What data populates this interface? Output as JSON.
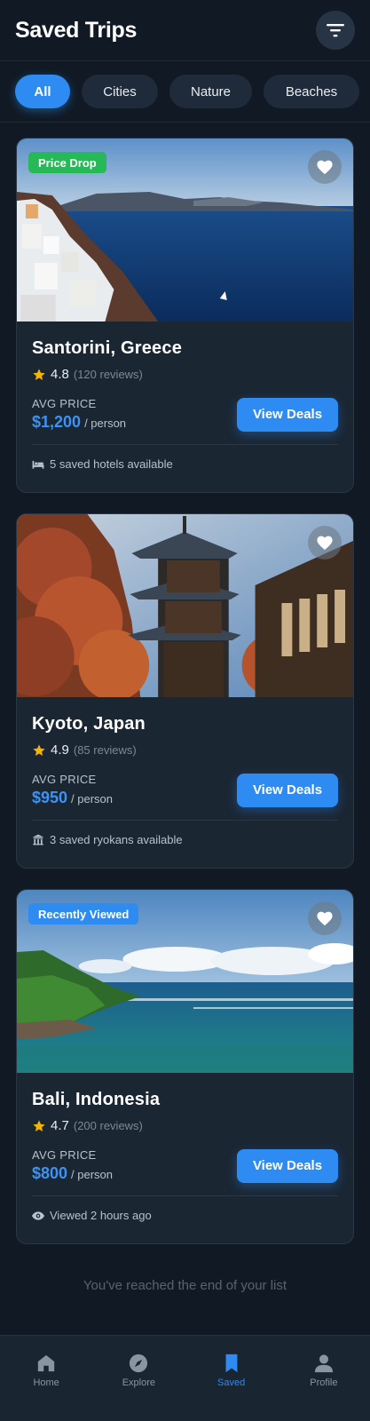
{
  "header": {
    "title": "Saved Trips",
    "filter_icon": "filter-icon"
  },
  "filters": [
    "All",
    "Cities",
    "Nature",
    "Beaches"
  ],
  "active_filter": "All",
  "cards": [
    {
      "badge": "Price Drop",
      "title": "Santorini, Greece",
      "rating": "4.8",
      "reviews": "(120 reviews)",
      "avg_label": "AVG PRICE",
      "price": "$1,200",
      "per": "/ person",
      "button": "View Deals",
      "meta": "5 saved hotels available",
      "meta_icon": "bed-icon"
    },
    {
      "badge": "",
      "title": "Kyoto, Japan",
      "rating": "4.9",
      "reviews": "(85 reviews)",
      "avg_label": "AVG PRICE",
      "price": "$950",
      "per": "/ person",
      "button": "View Deals",
      "meta": "3 saved ryokans available",
      "meta_icon": "temple-icon"
    },
    {
      "badge": "Recently Viewed",
      "title": "Bali, Indonesia",
      "rating": "4.7",
      "reviews": "(200 reviews)",
      "avg_label": "AVG PRICE",
      "price": "$800",
      "per": "/ person",
      "button": "View Deals",
      "meta": "Viewed 2 hours ago",
      "meta_icon": "eye-icon"
    }
  ],
  "end_note": "You've reached the end of your list",
  "nav": [
    {
      "label": "Home",
      "icon": "home-icon"
    },
    {
      "label": "Explore",
      "icon": "compass-icon"
    },
    {
      "label": "Saved",
      "icon": "bookmark-icon"
    },
    {
      "label": "Profile",
      "icon": "user-icon"
    }
  ],
  "active_nav": "Saved",
  "colors": {
    "accent": "#2d8bf2",
    "badge_green": "#27b857",
    "star": "#f5b400",
    "background": "#111a24"
  }
}
